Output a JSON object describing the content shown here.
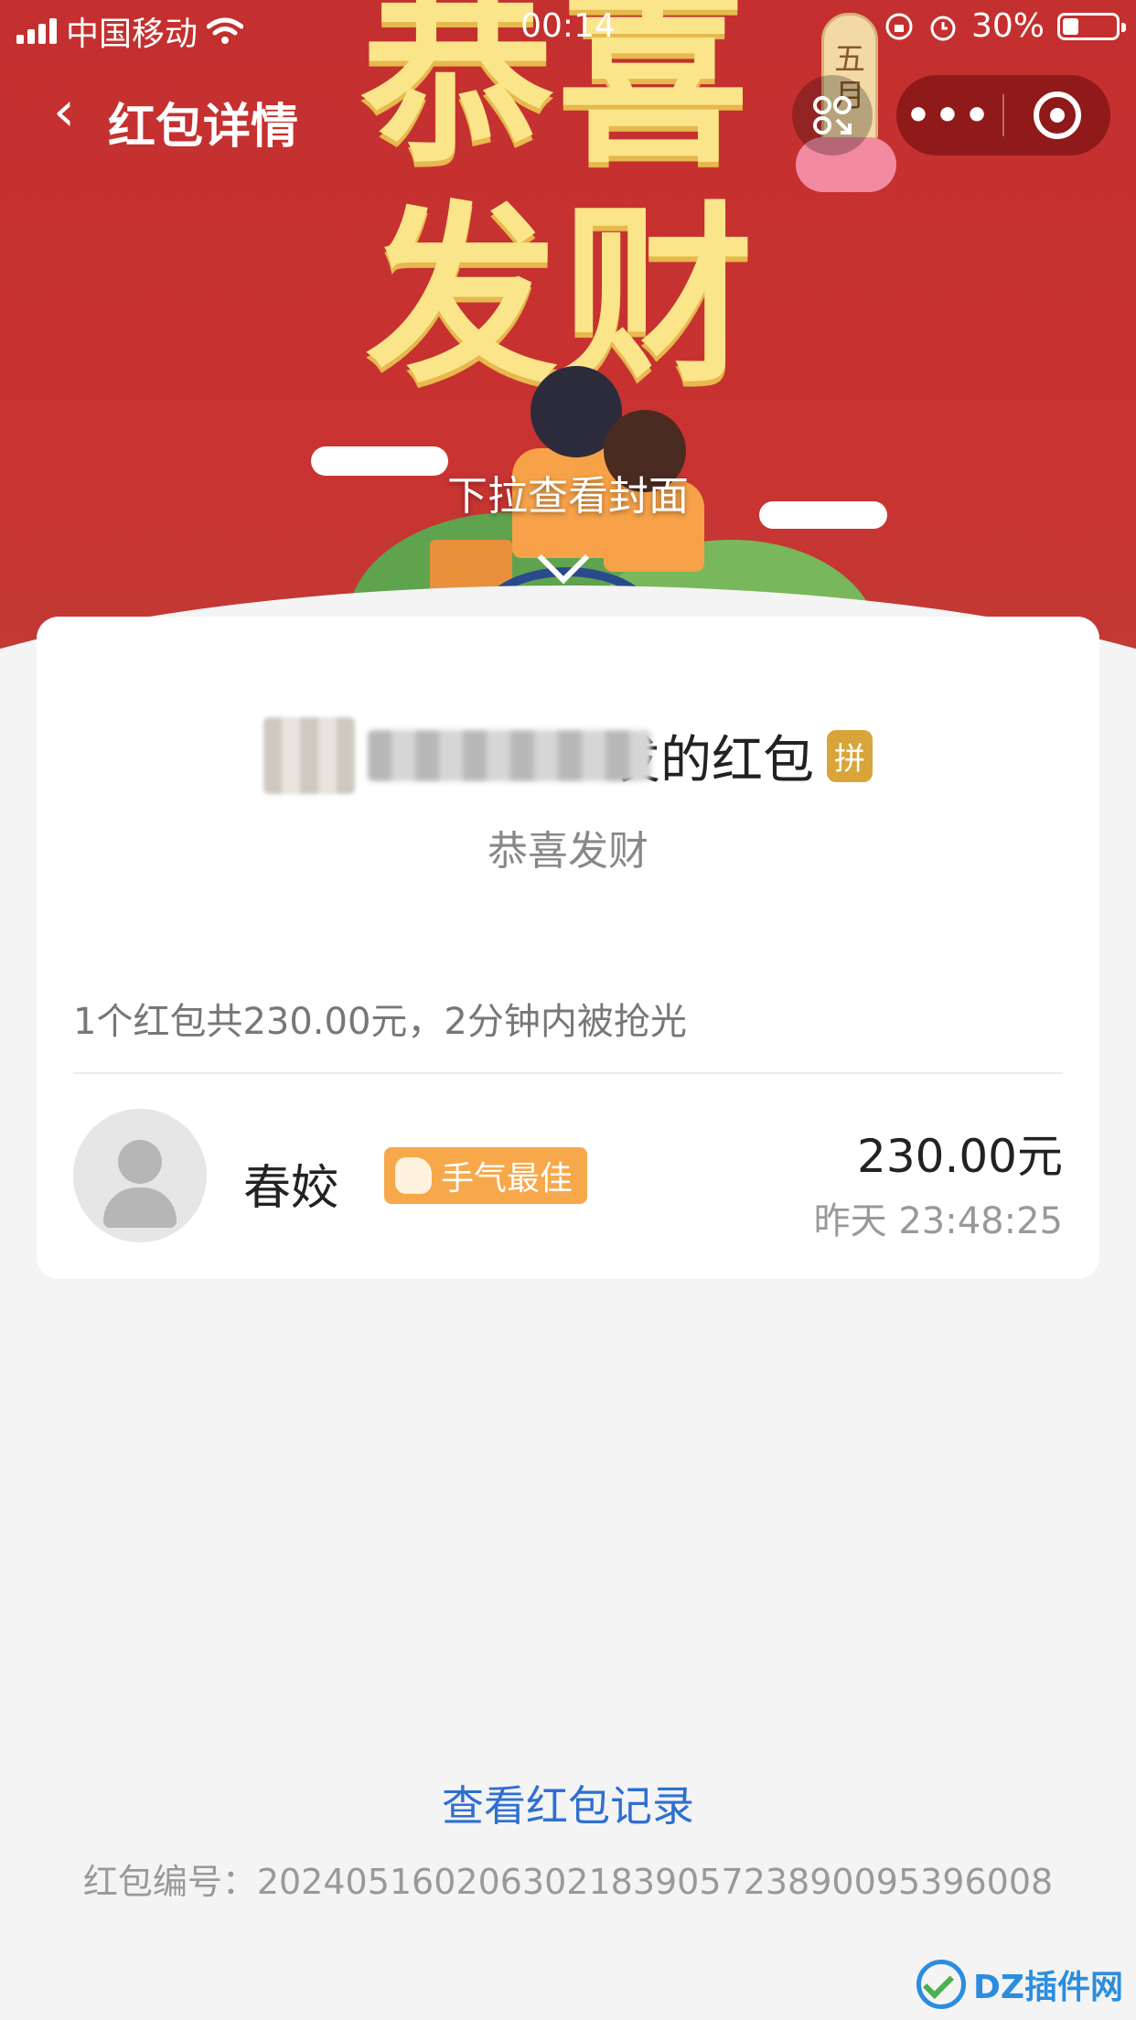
{
  "status_bar": {
    "carrier": "中国移动",
    "time": "00:14",
    "battery": "30%"
  },
  "nav": {
    "back_icon": "‹",
    "title": "红包详情",
    "more": "•••"
  },
  "cover": {
    "headline_1": "恭喜",
    "headline_2": "发财",
    "sign_text": "五月",
    "pull_hint": "下拉查看封面"
  },
  "sender": {
    "suffix": "发的红包",
    "badge": "拼",
    "blessing": "恭喜发财"
  },
  "summary": "1个红包共230.00元，2分钟内被抢光",
  "receivers": [
    {
      "name": "春姣",
      "badge": "手气最佳",
      "amount": "230.00元",
      "time": "昨天 23:48:25"
    }
  ],
  "footer": {
    "record_link": "查看红包记录",
    "serial": "红包编号：20240516020630218390572389009539​6008"
  },
  "watermark": {
    "text": "DZ插件网"
  }
}
